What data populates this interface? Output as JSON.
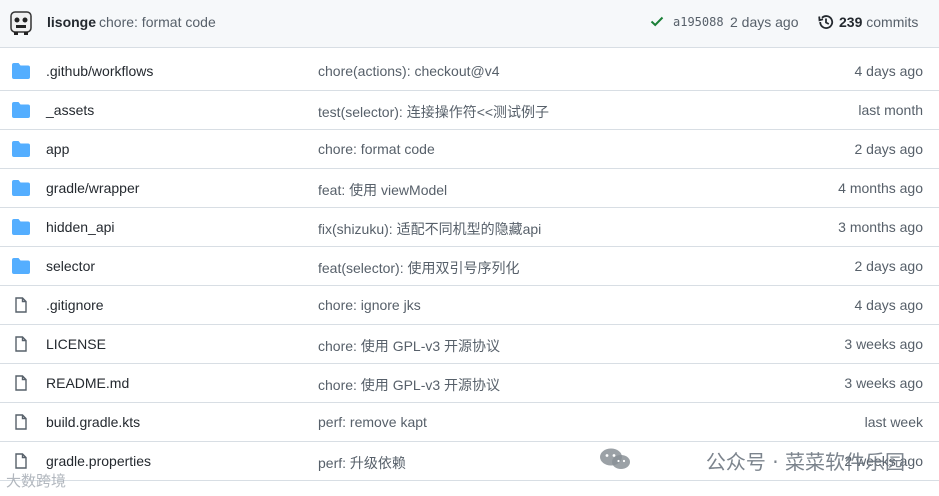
{
  "header": {
    "author": "lisonge",
    "message": "chore: format code",
    "sha": "a195088",
    "ago": "2 days ago",
    "commits_count": "239",
    "commits_label": "commits"
  },
  "files": [
    {
      "type": "folder",
      "name": ".github/workflows",
      "message": "chore(actions): checkout@v4",
      "time": "4 days ago"
    },
    {
      "type": "folder",
      "name": "_assets",
      "message": "test(selector): 连接操作符<<测试例子",
      "time": "last month"
    },
    {
      "type": "folder",
      "name": "app",
      "message": "chore: format code",
      "time": "2 days ago"
    },
    {
      "type": "folder",
      "name": "gradle/wrapper",
      "message": "feat: 使用 viewModel",
      "time": "4 months ago"
    },
    {
      "type": "folder",
      "name": "hidden_api",
      "message": "fix(shizuku): 适配不同机型的隐藏api",
      "time": "3 months ago"
    },
    {
      "type": "folder",
      "name": "selector",
      "message": "feat(selector): 使用双引号序列化",
      "time": "2 days ago"
    },
    {
      "type": "file",
      "name": ".gitignore",
      "message": "chore: ignore jks",
      "time": "4 days ago"
    },
    {
      "type": "file",
      "name": "LICENSE",
      "message": "chore: 使用 GPL-v3 开源协议",
      "time": "3 weeks ago"
    },
    {
      "type": "file",
      "name": "README.md",
      "message": "chore: 使用 GPL-v3 开源协议",
      "time": "3 weeks ago"
    },
    {
      "type": "file",
      "name": "build.gradle.kts",
      "message": "perf: remove kapt",
      "time": "last week"
    },
    {
      "type": "file",
      "name": "gradle.properties",
      "message": "perf: 升级依赖",
      "time": "2 weeks ago"
    }
  ],
  "watermark": "公众号 · 菜菜软件乐园",
  "corner_watermark": "大数跨境",
  "colors": {
    "folder": "#54aeff",
    "file": "#57606a",
    "check": "#1a7f37"
  }
}
